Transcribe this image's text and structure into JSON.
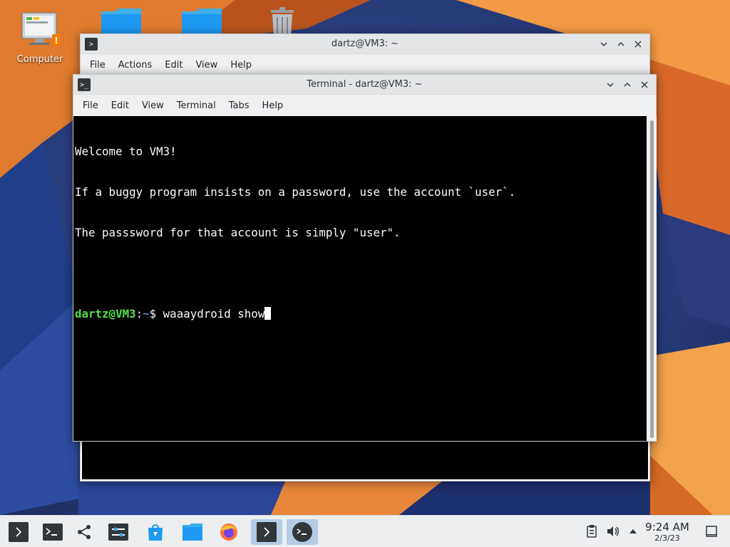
{
  "desktop": {
    "icons": [
      {
        "name": "computer",
        "label": "Computer"
      }
    ]
  },
  "back_window": {
    "title": "dartz@VM3: ~",
    "menu": [
      "File",
      "Actions",
      "Edit",
      "View",
      "Help"
    ],
    "controls": [
      "minimize",
      "maximize",
      "close"
    ]
  },
  "terminal": {
    "title": "Terminal - dartz@VM3: ~",
    "menu": [
      "File",
      "Edit",
      "View",
      "Terminal",
      "Tabs",
      "Help"
    ],
    "lines": [
      "Welcome to VM3!",
      "If a buggy program insists on a password, use the account `user`.",
      "The passsword for that account is simply \"user\"."
    ],
    "prompt": {
      "user_host": "dartz@VM3",
      "separator": ":",
      "path": "~",
      "symbol": "$ ",
      "command": "waaaydroid show"
    }
  },
  "taskbar": {
    "buttons": [
      "app-launcher",
      "terminal-launcher",
      "kde-connect",
      "system-settings",
      "discover-store",
      "file-manager",
      "firefox",
      "task-back-window",
      "task-terminal"
    ],
    "active": [
      "task-back-window",
      "task-terminal"
    ],
    "tray": [
      "clipboard",
      "volume",
      "expand-tray"
    ],
    "clock": {
      "time": "9:24 AM",
      "date": "2/3/23"
    }
  },
  "colors": {
    "prompt_user": "#54e14b",
    "prompt_path": "#7aa7ff",
    "taskbar_active": "#b3cbe5",
    "terminal_bg": "#000000"
  }
}
